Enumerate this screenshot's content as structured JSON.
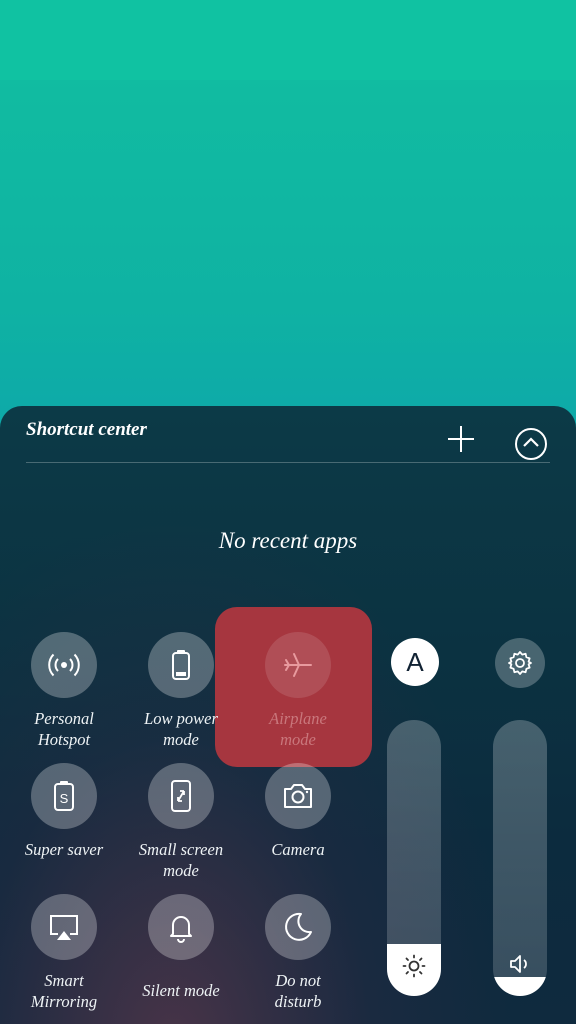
{
  "panel": {
    "title": "Shortcut center",
    "empty_message": "No recent apps"
  },
  "tiles": [
    {
      "label_line1": "Personal",
      "label_line2": "Hotspot",
      "icon": "hotspot-icon"
    },
    {
      "label_line1": "Low power",
      "label_line2": "mode",
      "icon": "battery-icon"
    },
    {
      "label_line1": "Airplane",
      "label_line2": "mode",
      "icon": "airplane-icon"
    },
    {
      "label_line1": "Super saver",
      "label_line2": "",
      "icon": "super-saver-icon"
    },
    {
      "label_line1": "Small screen",
      "label_line2": "mode",
      "icon": "small-screen-icon"
    },
    {
      "label_line1": "Camera",
      "label_line2": "",
      "icon": "camera-icon"
    },
    {
      "label_line1": "Smart",
      "label_line2": "Mirroring",
      "icon": "mirroring-icon"
    },
    {
      "label_line1": "Silent mode",
      "label_line2": "",
      "icon": "bell-icon"
    },
    {
      "label_line1": "Do not",
      "label_line2": "disturb",
      "icon": "moon-icon"
    }
  ],
  "auto_brightness": {
    "label": "A"
  },
  "brightness": {
    "level_percent": 19
  },
  "volume": {
    "level_percent": 7
  },
  "colors": {
    "airplane_highlight": "#a6363f",
    "panel": "#0b3241"
  }
}
